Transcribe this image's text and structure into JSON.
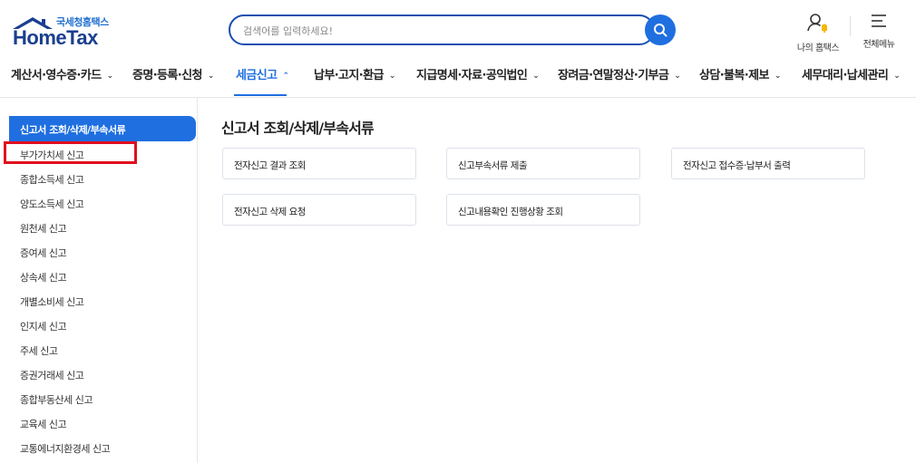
{
  "header": {
    "logo_sub": "국세청홈택스",
    "logo_main": "HomeTax",
    "search_placeholder": "검색어를 입력하세요!",
    "my_hometax": "나의 홈택스",
    "all_menu": "전체메뉴",
    "accent_color": "#1f6fe0"
  },
  "gnb": [
    {
      "label": "계산서·영수증·카드",
      "active": false
    },
    {
      "label": "증명·등록·신청",
      "active": false
    },
    {
      "label": "세금신고",
      "active": true
    },
    {
      "label": "납부·고지·환급",
      "active": false
    },
    {
      "label": "지급명세·자료·공익법인",
      "active": false
    },
    {
      "label": "장려금·연말정산·기부금",
      "active": false
    },
    {
      "label": "상담·불복·제보",
      "active": false
    },
    {
      "label": "세무대리·납세관리",
      "active": false
    }
  ],
  "sidebar": {
    "active": "신고서 조회/삭제/부속서류",
    "items": [
      "부가가치세 신고",
      "종합소득세 신고",
      "양도소득세 신고",
      "원천세 신고",
      "증여세 신고",
      "상속세 신고",
      "개별소비세 신고",
      "인지세 신고",
      "주세 신고",
      "증권거래세 신고",
      "종합부동산세 신고",
      "교육세 신고",
      "교통에너지환경세 신고"
    ]
  },
  "main": {
    "title": "신고서 조회/삭제/부속서류",
    "cards": [
      "전자신고 결과 조회",
      "신고부속서류 제출",
      "전자신고 접수증·납부서 출력",
      "전자신고 삭제 요청",
      "신고내용확인 진행상황 조회"
    ]
  }
}
